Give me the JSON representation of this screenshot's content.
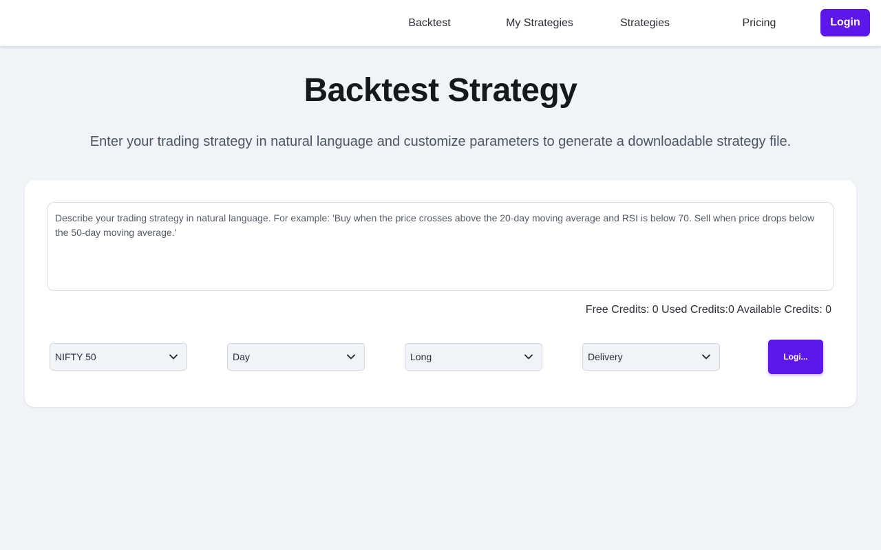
{
  "nav": {
    "links": [
      {
        "label": "Backtest"
      },
      {
        "label": "My Strategies"
      },
      {
        "label": "Strategies"
      },
      {
        "label": "Pricing"
      }
    ],
    "login_label": "Login"
  },
  "header": {
    "title": "Backtest Strategy",
    "subtitle": "Enter your trading strategy in natural language and customize parameters to generate a downloadable strategy file."
  },
  "form": {
    "strategy_placeholder": "Describe your trading strategy in natural language. For example: 'Buy when the price crosses above the 20-day moving average and RSI is below 70. Sell when price drops below the 50-day moving average.'",
    "strategy_value": "",
    "credits_text": "Free Credits: 0 Used Credits:0 Available Credits: 0",
    "selects": {
      "index": {
        "value": "NIFTY 50"
      },
      "timeframe": {
        "value": "Day"
      },
      "position": {
        "value": "Long"
      },
      "trade_type": {
        "value": "Delivery"
      }
    },
    "submit_label": "Logi..."
  },
  "colors": {
    "accent": "#5e17eb",
    "page_bg": "#f0f3f8",
    "card_bg": "#ffffff"
  },
  "icons": {
    "select_chevron": "chevron-down-icon"
  }
}
